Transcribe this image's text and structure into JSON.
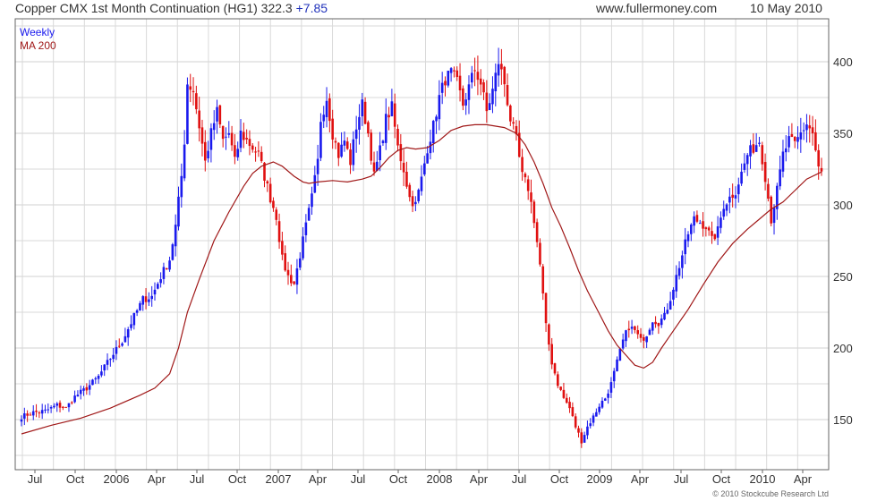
{
  "header": {
    "title": "Copper CMX 1st Month Continuation (HG1) 322.3",
    "change": "+7.85",
    "site": "www.fullermoney.com",
    "date": "10 May 2010"
  },
  "footer": {
    "copyright": "© 2010 Stockcube Research Ltd"
  },
  "colors": {
    "up": "#1a1aee",
    "down": "#e01010",
    "ma": "#a01818",
    "grid": "#d9d9d9",
    "frame": "#666666"
  },
  "chart_data": {
    "type": "candlestick",
    "legend": [
      "Weekly",
      "MA 200"
    ],
    "ylim": [
      115,
      430
    ],
    "y_ticks": [
      150,
      200,
      250,
      300,
      350,
      400
    ],
    "x_ticks": [
      "Jul",
      "Oct",
      "2006",
      "Apr",
      "Jul",
      "Oct",
      "2007",
      "Apr",
      "Jul",
      "Oct",
      "2008",
      "Apr",
      "Jul",
      "Oct",
      "2009",
      "Apr",
      "Jul",
      "Oct",
      "2010",
      "Apr"
    ],
    "close_path": [
      [
        0,
        152
      ],
      [
        4,
        155
      ],
      [
        8,
        156
      ],
      [
        12,
        160
      ],
      [
        15,
        158
      ],
      [
        18,
        166
      ],
      [
        22,
        172
      ],
      [
        26,
        180
      ],
      [
        30,
        193
      ],
      [
        34,
        205
      ],
      [
        38,
        222
      ],
      [
        41,
        234
      ],
      [
        44,
        236
      ],
      [
        47,
        250
      ],
      [
        50,
        262
      ],
      [
        52,
        285
      ],
      [
        54,
        320
      ],
      [
        55,
        345
      ],
      [
        56,
        385
      ],
      [
        58,
        380
      ],
      [
        60,
        355
      ],
      [
        62,
        330
      ],
      [
        64,
        350
      ],
      [
        66,
        365
      ],
      [
        68,
        345
      ],
      [
        70,
        350
      ],
      [
        72,
        330
      ],
      [
        74,
        350
      ],
      [
        76,
        345
      ],
      [
        78,
        340
      ],
      [
        80,
        335
      ],
      [
        82,
        320
      ],
      [
        84,
        305
      ],
      [
        86,
        292
      ],
      [
        88,
        262
      ],
      [
        90,
        250
      ],
      [
        92,
        245
      ],
      [
        94,
        265
      ],
      [
        96,
        285
      ],
      [
        98,
        305
      ],
      [
        100,
        330
      ],
      [
        101,
        360
      ],
      [
        103,
        375
      ],
      [
        105,
        350
      ],
      [
        107,
        335
      ],
      [
        109,
        345
      ],
      [
        111,
        330
      ],
      [
        113,
        355
      ],
      [
        115,
        370
      ],
      [
        117,
        350
      ],
      [
        119,
        320
      ],
      [
        121,
        338
      ],
      [
        123,
        360
      ],
      [
        125,
        368
      ],
      [
        127,
        340
      ],
      [
        129,
        325
      ],
      [
        131,
        305
      ],
      [
        133,
        300
      ],
      [
        135,
        318
      ],
      [
        137,
        340
      ],
      [
        139,
        355
      ],
      [
        141,
        375
      ],
      [
        143,
        388
      ],
      [
        145,
        392
      ],
      [
        147,
        385
      ],
      [
        149,
        370
      ],
      [
        151,
        382
      ],
      [
        153,
        395
      ],
      [
        155,
        385
      ],
      [
        157,
        365
      ],
      [
        159,
        380
      ],
      [
        161,
        400
      ],
      [
        163,
        385
      ],
      [
        165,
        360
      ],
      [
        167,
        345
      ],
      [
        169,
        320
      ],
      [
        171,
        312
      ],
      [
        173,
        290
      ],
      [
        175,
        258
      ],
      [
        177,
        215
      ],
      [
        179,
        190
      ],
      [
        181,
        175
      ],
      [
        183,
        165
      ],
      [
        185,
        158
      ],
      [
        187,
        145
      ],
      [
        189,
        135
      ],
      [
        191,
        145
      ],
      [
        193,
        152
      ],
      [
        195,
        160
      ],
      [
        197,
        165
      ],
      [
        199,
        175
      ],
      [
        201,
        190
      ],
      [
        203,
        205
      ],
      [
        205,
        215
      ],
      [
        207,
        212
      ],
      [
        209,
        205
      ],
      [
        211,
        210
      ],
      [
        213,
        220
      ],
      [
        215,
        218
      ],
      [
        217,
        222
      ],
      [
        219,
        235
      ],
      [
        221,
        250
      ],
      [
        223,
        265
      ],
      [
        225,
        280
      ],
      [
        227,
        290
      ],
      [
        229,
        288
      ],
      [
        231,
        285
      ],
      [
        233,
        275
      ],
      [
        235,
        282
      ],
      [
        237,
        300
      ],
      [
        239,
        305
      ],
      [
        241,
        310
      ],
      [
        243,
        322
      ],
      [
        245,
        335
      ],
      [
        247,
        340
      ],
      [
        249,
        345
      ],
      [
        251,
        320
      ],
      [
        253,
        290
      ],
      [
        255,
        310
      ],
      [
        257,
        335
      ],
      [
        259,
        345
      ],
      [
        261,
        342
      ],
      [
        263,
        350
      ],
      [
        265,
        357
      ],
      [
        267,
        350
      ],
      [
        269,
        325
      ],
      [
        270,
        322
      ]
    ],
    "ma200_path": [
      [
        0,
        140
      ],
      [
        10,
        146
      ],
      [
        20,
        151
      ],
      [
        30,
        158
      ],
      [
        40,
        167
      ],
      [
        45,
        172
      ],
      [
        50,
        182
      ],
      [
        53,
        200
      ],
      [
        56,
        225
      ],
      [
        60,
        248
      ],
      [
        65,
        275
      ],
      [
        70,
        295
      ],
      [
        75,
        313
      ],
      [
        78,
        322
      ],
      [
        81,
        327
      ],
      [
        85,
        330
      ],
      [
        88,
        327
      ],
      [
        92,
        320
      ],
      [
        95,
        316
      ],
      [
        97,
        315
      ],
      [
        100,
        316
      ],
      [
        105,
        317
      ],
      [
        110,
        316
      ],
      [
        115,
        318
      ],
      [
        118,
        320
      ],
      [
        121,
        326
      ],
      [
        124,
        333
      ],
      [
        127,
        338
      ],
      [
        130,
        340
      ],
      [
        133,
        339
      ],
      [
        137,
        340
      ],
      [
        141,
        345
      ],
      [
        145,
        352
      ],
      [
        149,
        355
      ],
      [
        153,
        356
      ],
      [
        157,
        356
      ],
      [
        160,
        355
      ],
      [
        163,
        354
      ],
      [
        167,
        350
      ],
      [
        170,
        342
      ],
      [
        173,
        330
      ],
      [
        176,
        315
      ],
      [
        179,
        298
      ],
      [
        182,
        285
      ],
      [
        185,
        270
      ],
      [
        188,
        254
      ],
      [
        191,
        240
      ],
      [
        195,
        224
      ],
      [
        198,
        212
      ],
      [
        201,
        202
      ],
      [
        204,
        195
      ],
      [
        207,
        188
      ],
      [
        210,
        186
      ],
      [
        213,
        190
      ],
      [
        216,
        200
      ],
      [
        220,
        212
      ],
      [
        225,
        227
      ],
      [
        230,
        244
      ],
      [
        235,
        260
      ],
      [
        240,
        273
      ],
      [
        245,
        283
      ],
      [
        249,
        290
      ],
      [
        253,
        297
      ],
      [
        257,
        302
      ],
      [
        261,
        310
      ],
      [
        265,
        318
      ],
      [
        270,
        323
      ]
    ],
    "n_candles": 271
  }
}
